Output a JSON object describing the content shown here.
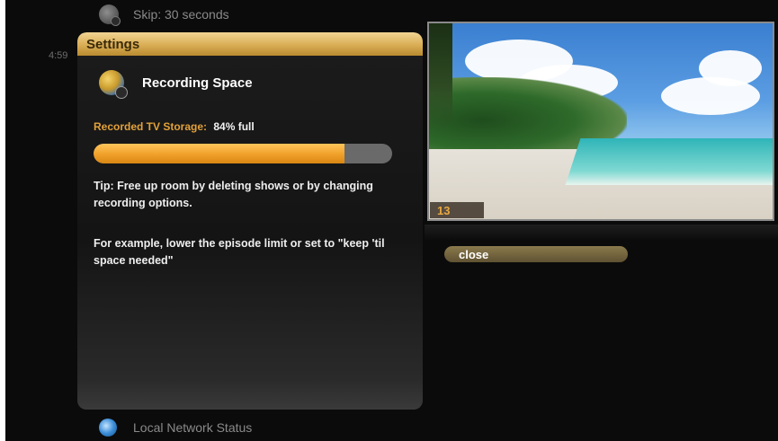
{
  "menu": {
    "skip_label": "Skip: 30 seconds",
    "time_label": "4:59",
    "network_label": "Local Network Status"
  },
  "settings": {
    "header": "Settings",
    "title": "Recording Space",
    "storage_label": "Recorded TV Storage:",
    "storage_value": "84% full",
    "storage_percent": 84,
    "tip": "Tip: Free up room by deleting shows or by changing recording options.",
    "example": "For example, lower the episode limit or set to \"keep 'til space needed\""
  },
  "preview": {
    "channel": "13"
  },
  "actions": {
    "close_label": "close"
  },
  "icons": {
    "skip": "skip-icon",
    "recording": "recording-space-icon",
    "network": "network-icon"
  },
  "colors": {
    "accent": "#e2a13a",
    "header_gold": "#d9ad55",
    "progress_fill": "#f0a02a",
    "progress_track": "#6a6a6a",
    "close_button": "#7a6b43"
  }
}
